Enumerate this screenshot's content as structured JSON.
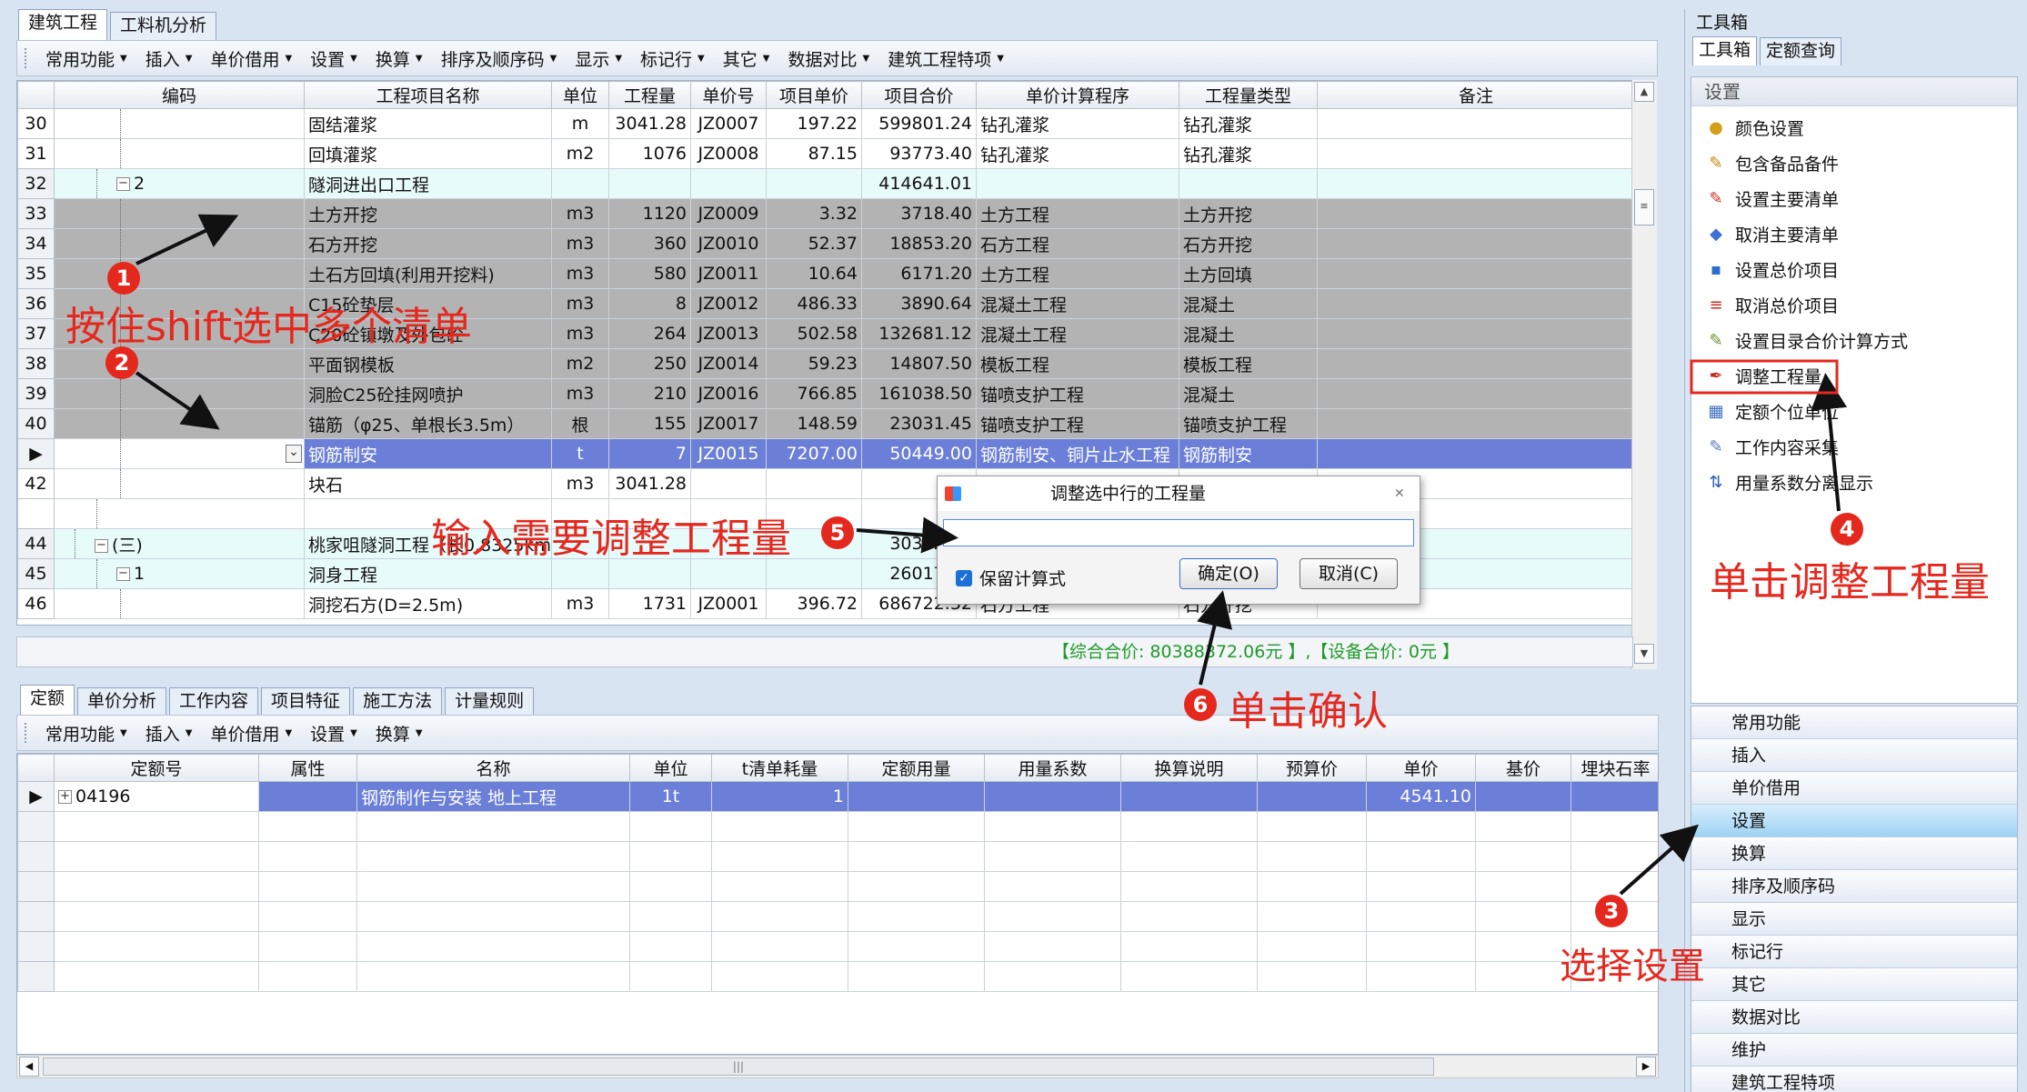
{
  "main_tabs": [
    "建筑工程",
    "工料机分析"
  ],
  "toolbar": [
    "常用功能",
    "插入",
    "单价借用",
    "设置",
    "换算",
    "排序及顺序码",
    "显示",
    "标记行",
    "其它",
    "数据对比",
    "建筑工程特项"
  ],
  "grid": {
    "columns": [
      "编码",
      "工程项目名称",
      "单位",
      "工程量",
      "单价号",
      "项目单价",
      "项目合价",
      "单价计算程序",
      "工程量类型",
      "备注"
    ],
    "rows": [
      {
        "n": "30",
        "code": "",
        "name": "固结灌浆",
        "unit": "m",
        "qty": "3041.28",
        "pid": "JZ0007",
        "price": "197.22",
        "total": "599801.24",
        "prog": "钻孔灌浆",
        "type": "钻孔灌浆",
        "style": "white",
        "level": 3
      },
      {
        "n": "31",
        "code": "",
        "name": "回填灌浆",
        "unit": "m2",
        "qty": "1076",
        "pid": "JZ0008",
        "price": "87.15",
        "total": "93773.40",
        "prog": "钻孔灌浆",
        "type": "钻孔灌浆",
        "style": "white",
        "level": 3
      },
      {
        "n": "32",
        "code": "2",
        "name": "隧洞进出口工程",
        "unit": "",
        "qty": "",
        "pid": "",
        "price": "",
        "total": "414641.01",
        "prog": "",
        "type": "",
        "style": "cyan",
        "level": 2,
        "exp": "−"
      },
      {
        "n": "33",
        "code": "",
        "name": "土方开挖",
        "unit": "m3",
        "qty": "1120",
        "pid": "JZ0009",
        "price": "3.32",
        "total": "3718.40",
        "prog": "土方工程",
        "type": "土方开挖",
        "style": "gray",
        "level": 3
      },
      {
        "n": "34",
        "code": "",
        "name": "石方开挖",
        "unit": "m3",
        "qty": "360",
        "pid": "JZ0010",
        "price": "52.37",
        "total": "18853.20",
        "prog": "石方工程",
        "type": "石方开挖",
        "style": "gray",
        "level": 3
      },
      {
        "n": "35",
        "code": "",
        "name": "土石方回填(利用开挖料)",
        "unit": "m3",
        "qty": "580",
        "pid": "JZ0011",
        "price": "10.64",
        "total": "6171.20",
        "prog": "土方工程",
        "type": "土方回填",
        "style": "gray",
        "level": 3
      },
      {
        "n": "36",
        "code": "",
        "name": "C15砼垫层",
        "unit": "m3",
        "qty": "8",
        "pid": "JZ0012",
        "price": "486.33",
        "total": "3890.64",
        "prog": "混凝土工程",
        "type": "混凝土",
        "style": "gray",
        "level": 3
      },
      {
        "n": "37",
        "code": "",
        "name": "C20砼镇墩及外包砼",
        "unit": "m3",
        "qty": "264",
        "pid": "JZ0013",
        "price": "502.58",
        "total": "132681.12",
        "prog": "混凝土工程",
        "type": "混凝土",
        "style": "gray",
        "level": 3
      },
      {
        "n": "38",
        "code": "",
        "name": "平面钢模板",
        "unit": "m2",
        "qty": "250",
        "pid": "JZ0014",
        "price": "59.23",
        "total": "14807.50",
        "prog": "模板工程",
        "type": "模板工程",
        "style": "gray",
        "level": 3
      },
      {
        "n": "39",
        "code": "",
        "name": "洞脸C25砼挂网喷护",
        "unit": "m3",
        "qty": "210",
        "pid": "JZ0016",
        "price": "766.85",
        "total": "161038.50",
        "prog": "锚喷支护工程",
        "type": "混凝土",
        "style": "gray",
        "level": 3
      },
      {
        "n": "40",
        "code": "",
        "name": "锚筋（φ25、单根长3.5m）",
        "unit": "根",
        "qty": "155",
        "pid": "JZ0017",
        "price": "148.59",
        "total": "23031.45",
        "prog": "锚喷支护工程",
        "type": "锚喷支护工程",
        "style": "gray",
        "level": 3
      },
      {
        "n": "▶",
        "code": "",
        "name": "钢筋制安",
        "unit": "t",
        "qty": "7",
        "pid": "JZ0015",
        "price": "7207.00",
        "total": "50449.00",
        "prog": "钢筋制安、铜片止水工程",
        "type": "钢筋制安",
        "style": "sel",
        "level": 3,
        "combo": true
      },
      {
        "n": "42",
        "code": "",
        "name": "块石",
        "unit": "m3",
        "qty": "3041.28",
        "pid": "",
        "price": "",
        "total": "",
        "prog": "",
        "type": "",
        "style": "white",
        "level": 3
      },
      {
        "n": "",
        "code": "",
        "name": "",
        "unit": "",
        "qty": "",
        "pid": "",
        "price": "",
        "total": "",
        "prog": "",
        "type": "",
        "style": "white",
        "level": 2
      },
      {
        "n": "44",
        "code": "(三)",
        "name": "桃家咀隧洞工程（长0.8325km）",
        "unit": "",
        "qty": "",
        "pid": "",
        "price": "",
        "total": "3030295.",
        "prog": "",
        "type": "",
        "style": "cyan",
        "level": 1,
        "exp": "−"
      },
      {
        "n": "45",
        "code": "1",
        "name": "洞身工程",
        "unit": "",
        "qty": "",
        "pid": "",
        "price": "",
        "total": "2601733.",
        "prog": "",
        "type": "",
        "style": "cyan",
        "level": 2,
        "exp": "−"
      },
      {
        "n": "46",
        "code": "",
        "name": "洞挖石方(D=2.5m)",
        "unit": "m3",
        "qty": "1731",
        "pid": "JZ0001",
        "price": "396.72",
        "total": "686722.32",
        "prog": "石方工程",
        "type": "石方开挖",
        "style": "white",
        "level": 3
      }
    ],
    "summary": "【综合合价: 80388372.06元 】,【设备合价: 0元 】"
  },
  "bottom": {
    "tabs": [
      "定额",
      "单价分析",
      "工作内容",
      "项目特征",
      "施工方法",
      "计量规则"
    ],
    "toolbar": [
      "常用功能",
      "插入",
      "单价借用",
      "设置",
      "换算"
    ],
    "columns": [
      "定额号",
      "属性",
      "名称",
      "单位",
      "t清单耗量",
      "定额用量",
      "用量系数",
      "换算说明",
      "预算价",
      "单价",
      "基价",
      "埋块石率"
    ],
    "row": {
      "code": "04196",
      "attr": "",
      "name": "钢筋制作与安装 地上工程",
      "unit": "1t",
      "consume": "1",
      "usage": "",
      "coef": "",
      "note": "",
      "budget": "",
      "price": "4541.10",
      "base": "",
      "rate": ""
    }
  },
  "toolbox": {
    "title": "工具箱",
    "tabs": [
      "工具箱",
      "定额查询"
    ],
    "section": "设置",
    "items": [
      {
        "label": "颜色设置",
        "icon": "palette-icon",
        "glyph": "●",
        "color": "#d4a017"
      },
      {
        "label": "包含备品备件",
        "icon": "pencil-icon",
        "glyph": "✎",
        "color": "#c08a00"
      },
      {
        "label": "设置主要清单",
        "icon": "pen-red-icon",
        "glyph": "✎",
        "color": "#d0321e"
      },
      {
        "label": "取消主要清单",
        "icon": "eraser-icon",
        "glyph": "◆",
        "color": "#3c6fd8"
      },
      {
        "label": "设置总价项目",
        "icon": "add-total-icon",
        "glyph": "▪",
        "color": "#2a6fd0"
      },
      {
        "label": "取消总价项目",
        "icon": "remove-total-icon",
        "glyph": "≡",
        "color": "#c03020"
      },
      {
        "label": "设置目录合价计算方式",
        "icon": "catalog-icon",
        "glyph": "✎",
        "color": "#6a8f2a"
      },
      {
        "label": "调整工程量",
        "icon": "adjust-pen-icon",
        "glyph": "✒",
        "color": "#c02a1e"
      },
      {
        "label": "定额个位单位",
        "icon": "quota-unit-icon",
        "glyph": "▦",
        "color": "#3d6fc0"
      },
      {
        "label": "工作内容采集",
        "icon": "collect-icon",
        "glyph": "✎",
        "color": "#5c7bb0"
      },
      {
        "label": "用量系数分离显示",
        "icon": "separate-icon",
        "glyph": "⇅",
        "color": "#2a5fb0"
      }
    ],
    "accordion": [
      "常用功能",
      "插入",
      "单价借用",
      "设置",
      "换算",
      "排序及顺序码",
      "显示",
      "标记行",
      "其它",
      "数据对比",
      "维护",
      "建筑工程特项"
    ]
  },
  "dialog": {
    "title": "调整选中行的工程量",
    "input_value": "",
    "checkbox_label": "保留计算式",
    "ok": "确定(O)",
    "cancel": "取消(C)"
  },
  "annotations": {
    "a1": "按住shift选中多个清单",
    "a3": "选择设置",
    "a4": "单击调整工程量",
    "a5": "输入需要调整工程量",
    "a6": "单击确认",
    "n1": "1",
    "n2": "2",
    "n3": "3",
    "n4": "4",
    "n5": "5",
    "n6": "6"
  }
}
